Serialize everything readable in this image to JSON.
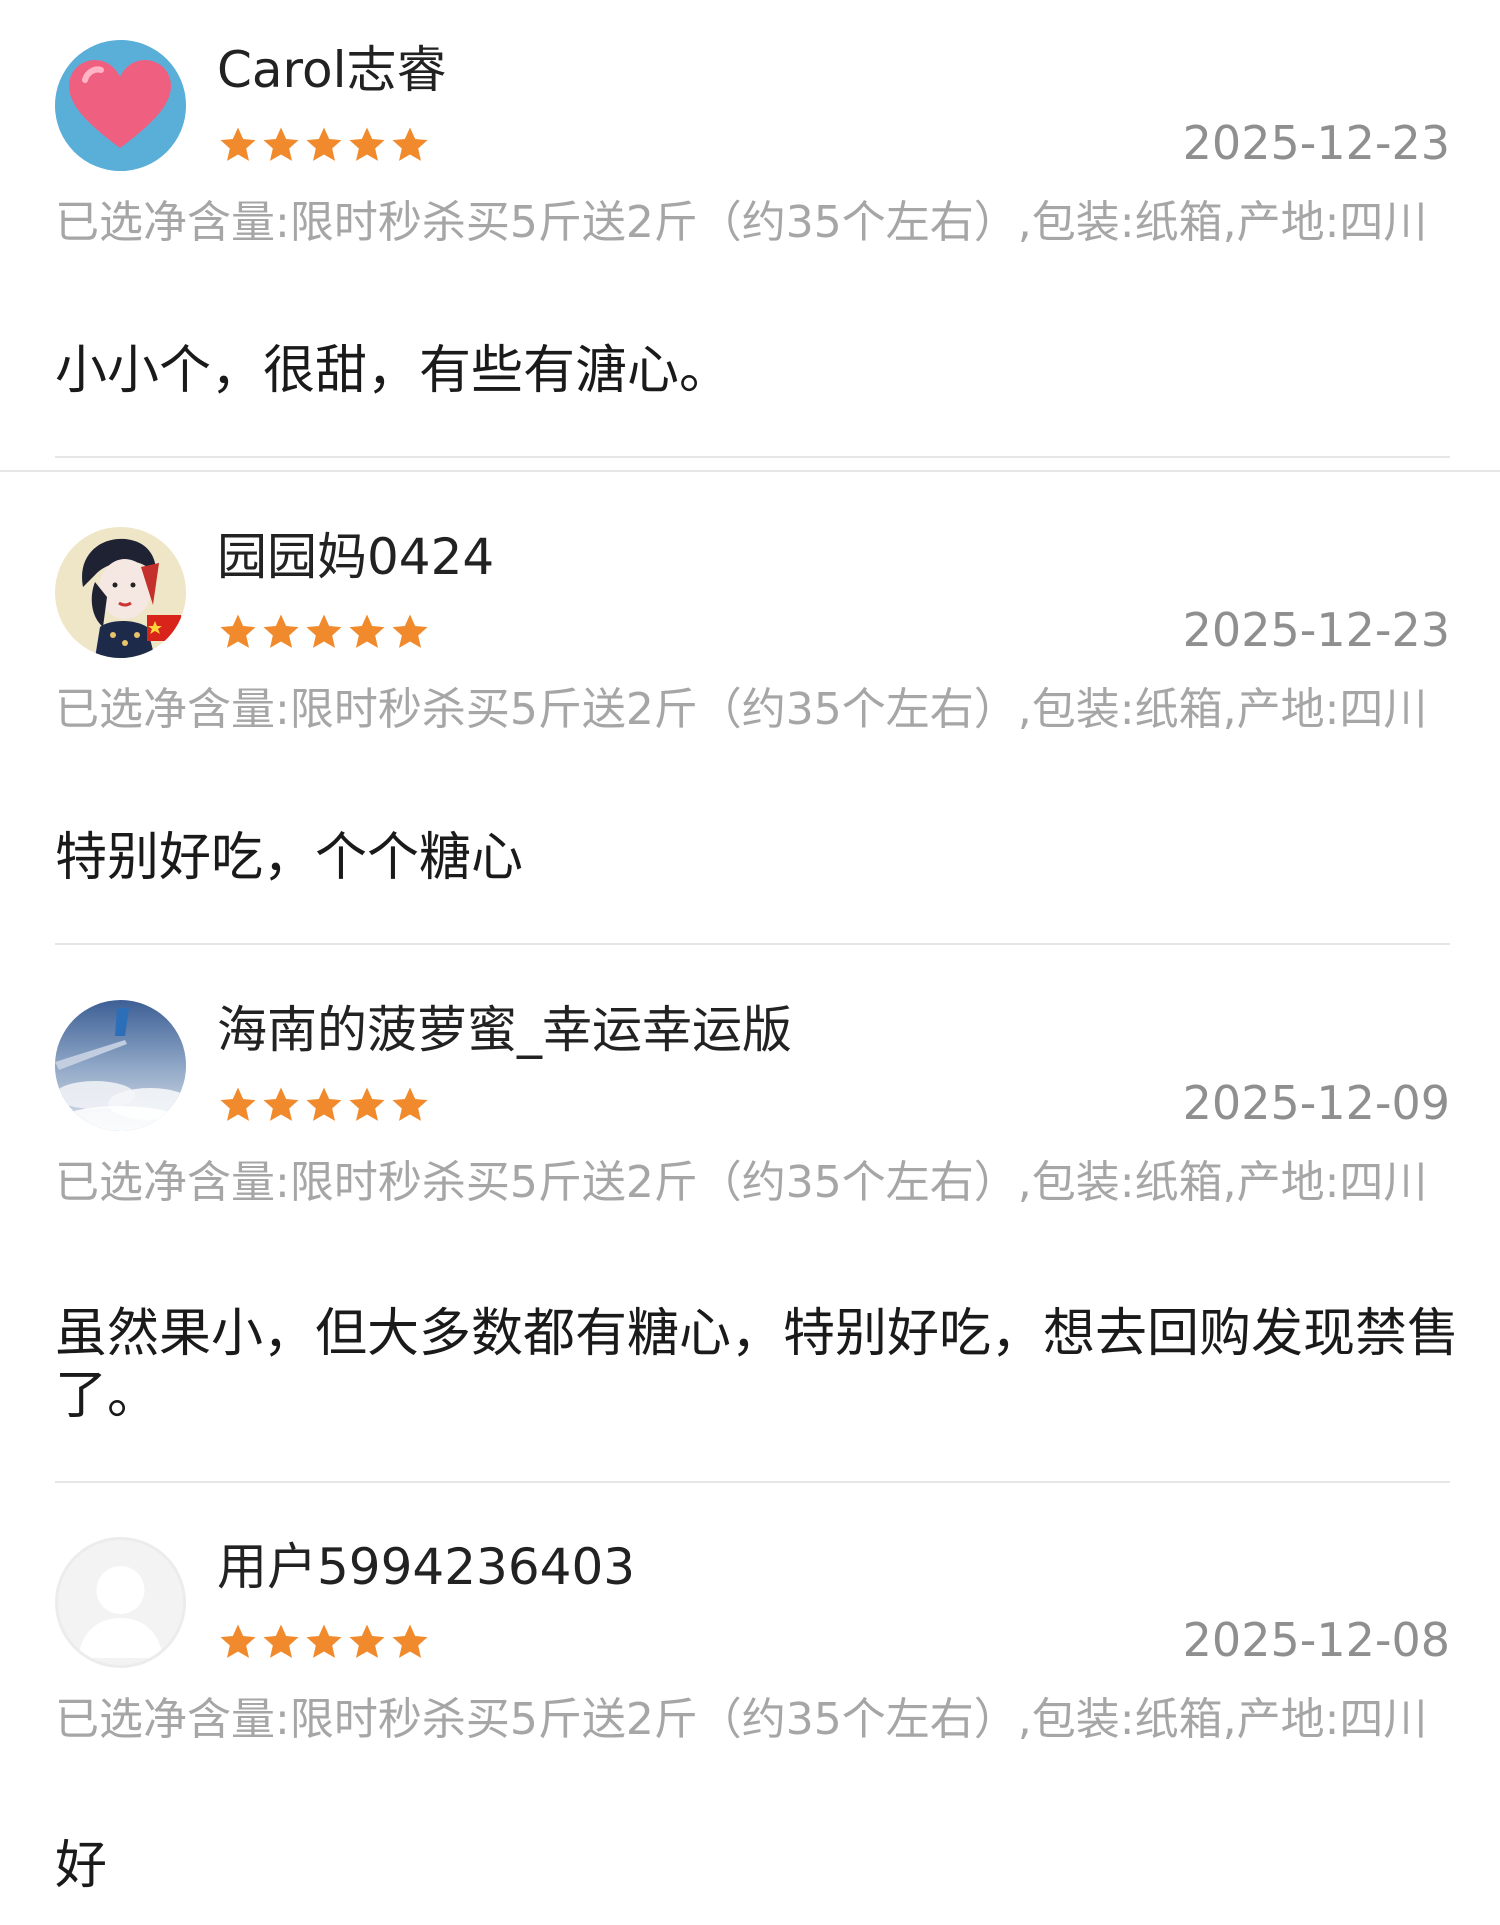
{
  "reviews": [
    {
      "username": "Carol志睿",
      "rating": 5,
      "date": "2025-12-23",
      "spec": "已选净含量:限时秒杀买5斤送2斤（约35个左右）,包装:纸箱,产地:四川",
      "content": "小小个，很甜，有些有溏心。",
      "avatar_icon": "heart-avatar"
    },
    {
      "username": "园园妈0424",
      "rating": 5,
      "date": "2025-12-23",
      "spec": "已选净含量:限时秒杀买5斤送2斤（约35个左右）,包装:纸箱,产地:四川",
      "content": "特别好吃，个个糖心",
      "avatar_icon": "illustrated-woman-avatar"
    },
    {
      "username": "海南的菠萝蜜_幸运幸运版",
      "rating": 5,
      "date": "2025-12-09",
      "spec": "已选净含量:限时秒杀买5斤送2斤（约35个左右）,包装:纸箱,产地:四川",
      "content": "虽然果小，但大多数都有糖心，特别好吃，想去回购发现禁售了。",
      "avatar_icon": "airplane-wing-sky-avatar"
    },
    {
      "username": "用户5994236403",
      "rating": 5,
      "date": "2025-12-08",
      "spec": "已选净含量:限时秒杀买5斤送2斤（约35个左右）,包装:纸箱,产地:四川",
      "content": "好",
      "avatar_icon": "default-user-avatar"
    }
  ],
  "colors": {
    "star": "#f08a2c",
    "username": "#222222",
    "date": "#8f8f8f",
    "spec": "#a6a6a6",
    "content": "#1a1a1a",
    "divider": "#e6e6e6"
  }
}
